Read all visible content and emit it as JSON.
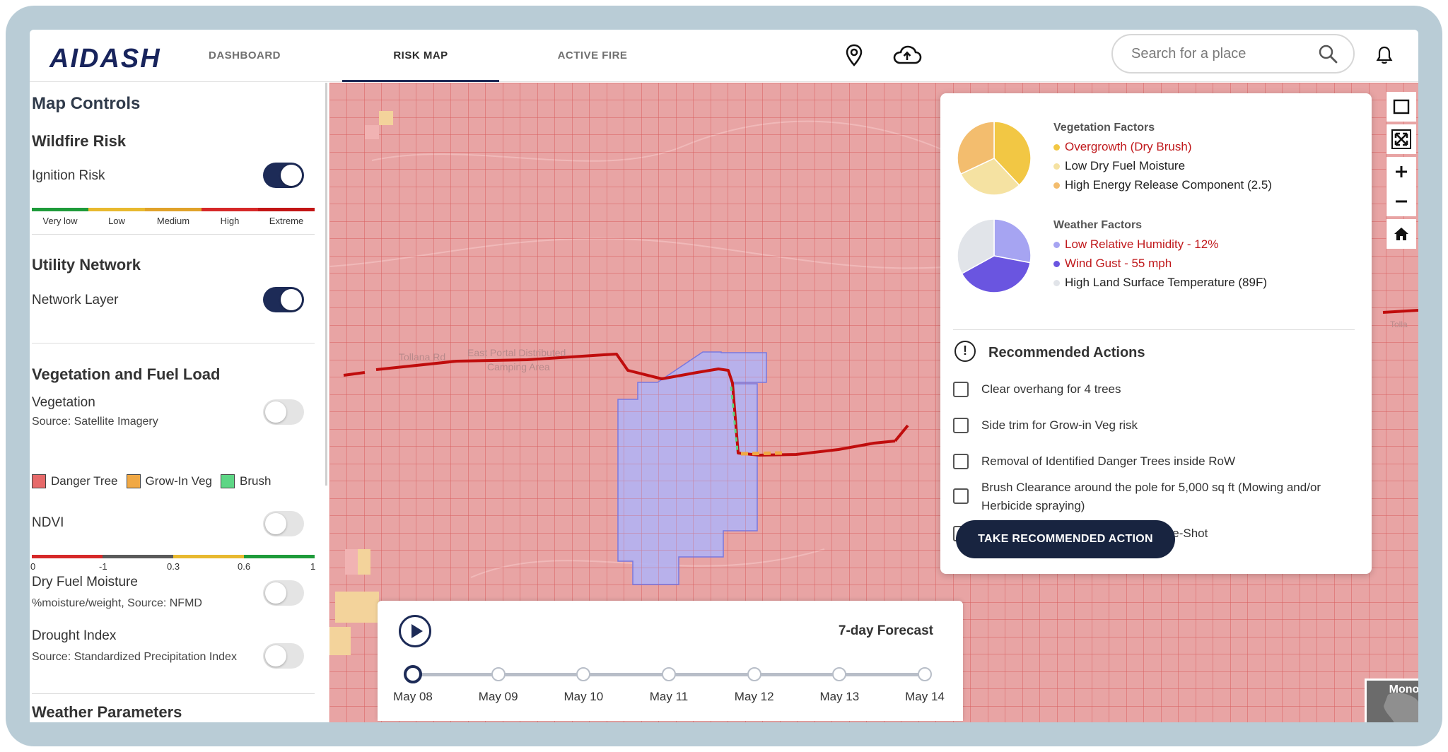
{
  "app": {
    "logo_text": "AIDASH"
  },
  "nav": {
    "tabs": [
      {
        "label": "DASHBOARD"
      },
      {
        "label": "RISK MAP"
      },
      {
        "label": "ACTIVE FIRE"
      }
    ],
    "active_tab": "RISK MAP",
    "icons": [
      "location-pin-icon",
      "cloud-upload-icon",
      "bell-icon"
    ]
  },
  "search": {
    "placeholder": "Search for a place",
    "value": ""
  },
  "sidebar": {
    "title": "Map Controls",
    "wildfire": {
      "heading": "Wildfire Risk",
      "ignition_label": "Ignition Risk",
      "ignition_on": true,
      "scale": [
        "Very low",
        "Low",
        "Medium",
        "High",
        "Extreme"
      ],
      "scale_colors": [
        "#1e9b3a",
        "#e8b92f",
        "#e0a22a",
        "#d62828",
        "#c21515"
      ]
    },
    "utility": {
      "heading": "Utility Network",
      "network_label": "Network Layer",
      "network_on": true
    },
    "vegetation": {
      "heading": "Vegetation and Fuel Load",
      "veg_label": "Vegetation",
      "veg_source": "Source: Satellite Imagery",
      "veg_on": false,
      "legend": [
        {
          "label": "Danger Tree",
          "color": "#e76a6a"
        },
        {
          "label": "Grow-In Veg",
          "color": "#f0a844"
        },
        {
          "label": "Brush",
          "color": "#5dd685"
        }
      ],
      "ndvi_label": "NDVI",
      "ndvi_on": false,
      "ndvi_ticks": [
        "0",
        "-1",
        "0.3",
        "0.6",
        "1"
      ],
      "dfm_label": "Dry Fuel Moisture",
      "dfm_source": "%moisture/weight, Source: NFMD",
      "dfm_on": false,
      "drought_label": "Drought Index",
      "drought_source": "Source: Standardized Precipitation Index",
      "drought_on": false
    },
    "weather_heading": "Weather Parameters"
  },
  "map": {
    "labels": [
      "Tollana Rd",
      "East Portal Distributed",
      "Camping Area",
      "Tolla"
    ]
  },
  "factors": {
    "vegetation": {
      "title": "Vegetation Factors",
      "items": [
        {
          "label": "Overgrowth (Dry Brush)",
          "color": "#f2c744",
          "alert": true,
          "share": 0.38
        },
        {
          "label": "Low Dry Fuel Moisture",
          "color": "#f5e2a2",
          "alert": false,
          "share": 0.3
        },
        {
          "label": "High Energy Release Component (2.5)",
          "color": "#f3bd6e",
          "alert": false,
          "share": 0.32
        }
      ]
    },
    "weather": {
      "title": "Weather Factors",
      "items": [
        {
          "label": "Low Relative Humidity - 12%",
          "color": "#a6a4f2",
          "alert": true,
          "share": 0.28
        },
        {
          "label": "Wind Gust - 55 mph",
          "color": "#6a55e0",
          "alert": true,
          "share": 0.39
        },
        {
          "label": "High Land Surface Temperature (89F)",
          "color": "#e1e4e9",
          "alert": false,
          "share": 0.33
        }
      ]
    }
  },
  "recommended": {
    "title": "Recommended Actions",
    "actions": [
      "Clear overhang for 4 trees",
      "Side trim for Grow-in Veg risk",
      "Removal of Identified Danger Trees inside RoW",
      "Brush Clearance around the pole for 5,000 sq ft (Mowing and/or Herbicide spraying)",
      "Change Circuit Breaker mode to One-Shot"
    ],
    "button_label": "TAKE RECOMMENDED ACTION"
  },
  "map_tools": [
    "square-select-icon",
    "fullscreen-icon",
    "zoom-in-icon",
    "zoom-out-icon",
    "home-icon"
  ],
  "forecast": {
    "title": "7-day Forecast",
    "dates": [
      "May 08",
      "May 09",
      "May 10",
      "May 11",
      "May 12",
      "May 13",
      "May 14"
    ],
    "selected_index": 0
  },
  "basemap": {
    "label": "Mono"
  },
  "colors": {
    "brand": "#1d2b57",
    "risk_fill": "#e39e9e",
    "grid_line": "#d65a5a",
    "power_line": "#c00d0d",
    "selection": "#b3b3f3",
    "alert_text": "#c0191c"
  }
}
